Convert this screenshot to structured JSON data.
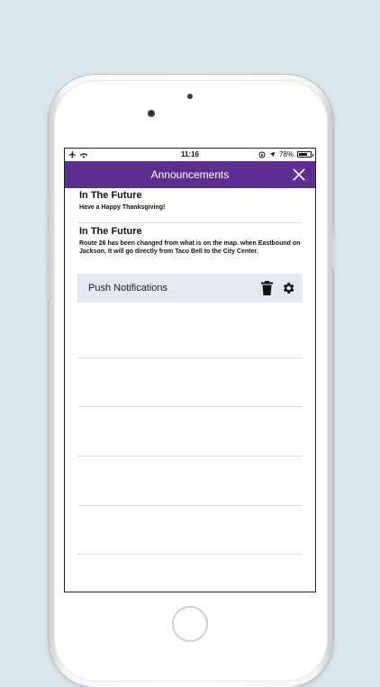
{
  "status_bar": {
    "time": "11:16",
    "battery": "78%",
    "battery_level": 0.78,
    "icons": [
      "airplane-icon",
      "wifi-icon",
      "rotation-lock-icon",
      "location-arrow-icon",
      "battery-icon"
    ]
  },
  "nav": {
    "title": "Announcements",
    "close_icon": "close-icon",
    "color": "#5b2d8e"
  },
  "announcements": [
    {
      "title": "In The Future",
      "body": "Have a Happy Thanksgiving!"
    },
    {
      "title": "In The Future",
      "body": "Route 26 has been changed from what is on the map.  when Eastbound on Jackson, It will go directly from Taco Bell to the City Center."
    }
  ],
  "push": {
    "label": "Push Notifications",
    "trash_icon": "trash-icon",
    "gear_icon": "gear-icon",
    "background": "#e5e7f3"
  }
}
